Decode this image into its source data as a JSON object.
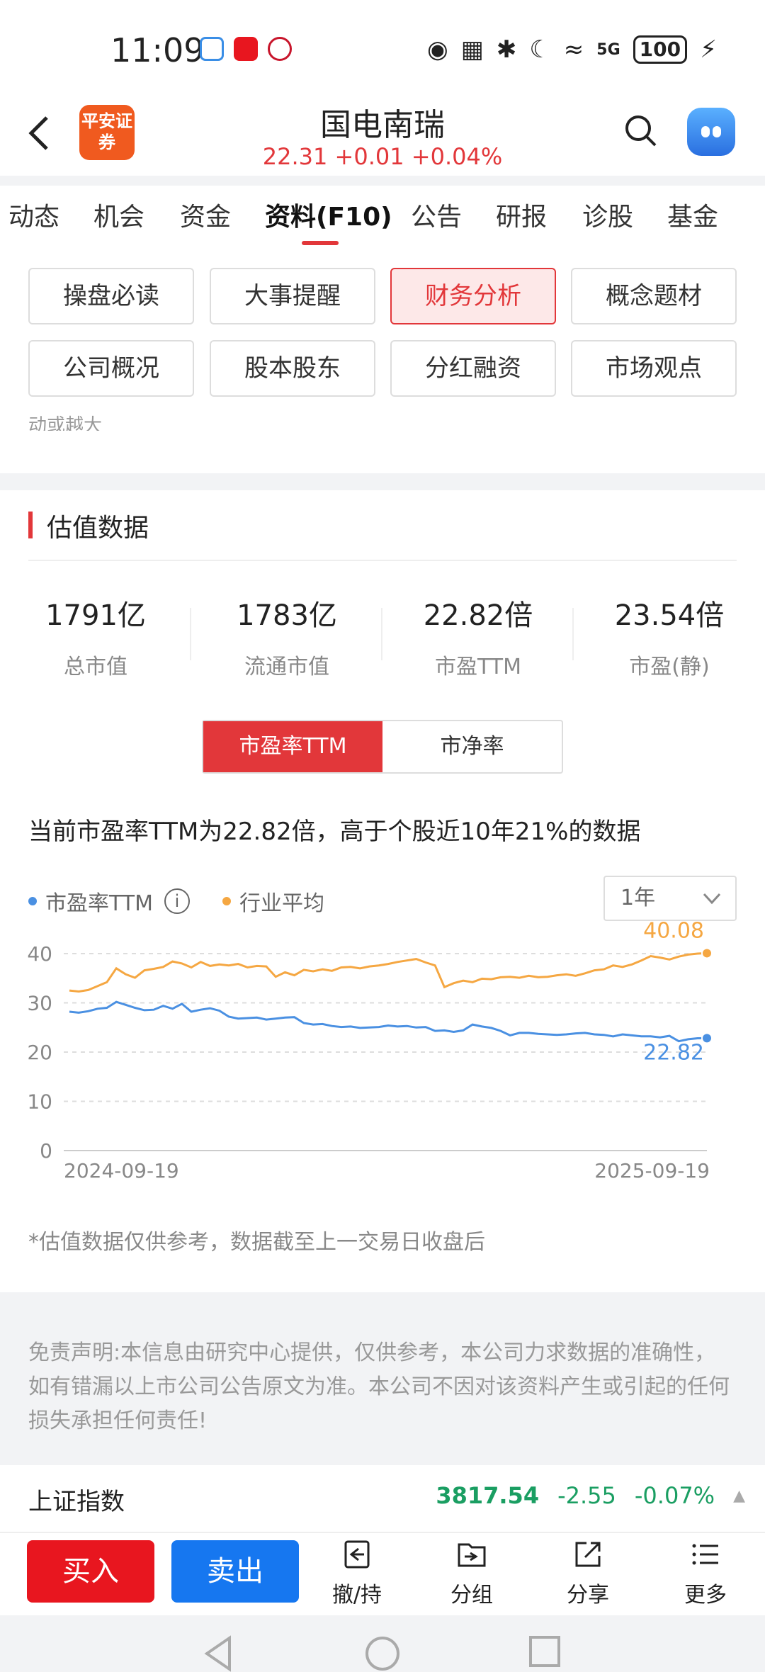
{
  "status": {
    "time": "11:09",
    "network": "5G",
    "battery": "100"
  },
  "header": {
    "logo_text": "平安证券",
    "stock_name": "国电南瑞",
    "quote": "22.31 +0.01 +0.04%",
    "quote_color": "#e2373a"
  },
  "tabs": [
    "动态",
    "机会",
    "资金",
    "资料(F10)",
    "公告",
    "研报",
    "诊股",
    "基金"
  ],
  "active_tab": "资料(F10)",
  "grid": {
    "row1": [
      "操盘必读",
      "大事提醒",
      "财务分析",
      "概念题材"
    ],
    "row2": [
      "公司概况",
      "股本股东",
      "分红融资",
      "市场观点"
    ],
    "active": "财务分析",
    "clipped_text": "动或越大"
  },
  "valuation": {
    "title": "估值数据",
    "metrics": [
      {
        "value": "1791亿",
        "label": "总市值"
      },
      {
        "value": "1783亿",
        "label": "流通市值"
      },
      {
        "value": "22.82倍",
        "label": "市盈TTM"
      },
      {
        "value": "23.54倍",
        "label": "市盈(静)"
      }
    ],
    "toggle": [
      "市盈率TTM",
      "市净率"
    ],
    "toggle_active": "市盈率TTM",
    "description": "当前市盈率TTM为22.82倍，高于个股近10年21%的数据",
    "legend": [
      "市盈率TTM",
      "行业平均"
    ],
    "range": "1年",
    "note": "*估值数据仅供参考，数据截至上一交易日收盘后"
  },
  "chart_data": {
    "type": "line",
    "x_start": "2024-09-19",
    "x_end": "2025-09-19",
    "xlabel": "",
    "ylabel": "",
    "ylim": [
      0,
      40
    ],
    "yticks": [
      0,
      10,
      20,
      30,
      40
    ],
    "grid": true,
    "legend_position": "top-left",
    "series": [
      {
        "name": "市盈率TTM",
        "color": "#4a90e2",
        "last_label": "22.82",
        "values": [
          28.2,
          28.0,
          28.3,
          28.8,
          29.0,
          30.2,
          29.6,
          29.0,
          28.5,
          28.6,
          29.4,
          28.8,
          29.8,
          28.2,
          28.6,
          28.9,
          28.4,
          27.2,
          26.8,
          26.9,
          27.0,
          26.6,
          26.8,
          27.0,
          27.1,
          25.9,
          25.6,
          25.7,
          25.3,
          25.1,
          25.2,
          24.9,
          25.0,
          25.1,
          25.4,
          25.2,
          25.3,
          25.0,
          25.1,
          24.3,
          24.4,
          24.1,
          24.4,
          25.6,
          25.2,
          24.9,
          24.3,
          23.4,
          23.9,
          23.9,
          23.7,
          23.6,
          23.5,
          23.6,
          23.8,
          23.9,
          23.6,
          23.5,
          23.2,
          23.6,
          23.4,
          23.2,
          23.2,
          23.0,
          23.3,
          22.2,
          22.6,
          22.8,
          22.82
        ]
      },
      {
        "name": "行业平均",
        "color": "#f5a742",
        "last_label": "40.08",
        "values": [
          32.5,
          32.3,
          32.6,
          33.4,
          34.2,
          37.0,
          35.8,
          35.1,
          36.6,
          36.9,
          37.3,
          38.4,
          38.0,
          37.2,
          38.3,
          37.5,
          37.8,
          37.6,
          37.9,
          37.2,
          37.5,
          37.4,
          35.3,
          36.2,
          35.6,
          36.7,
          36.4,
          36.8,
          36.5,
          37.2,
          37.3,
          37.0,
          37.4,
          37.6,
          37.9,
          38.3,
          38.6,
          38.9,
          38.2,
          37.6,
          33.2,
          34.0,
          34.5,
          34.2,
          34.9,
          34.8,
          35.2,
          35.3,
          35.1,
          35.5,
          35.2,
          35.3,
          35.6,
          35.8,
          35.5,
          36.0,
          36.6,
          36.8,
          37.6,
          37.3,
          37.8,
          38.6,
          39.5,
          39.2,
          38.8,
          39.4,
          39.8,
          40.0,
          40.08
        ]
      }
    ]
  },
  "disclaimer": "免责声明:本信息由研究中心提供，仅供参考，本公司力求数据的准确性，如有错漏以上市公司公告原文为准。本公司不因对该资料产生或引起的任何损失承担任何责任!",
  "index_bar": {
    "name": "上证指数",
    "value": "3817.54",
    "change": "-2.55",
    "pct": "-0.07%"
  },
  "actions": {
    "buy": "买入",
    "sell": "卖出",
    "items": [
      "撤/持",
      "分组",
      "分享",
      "更多"
    ]
  }
}
